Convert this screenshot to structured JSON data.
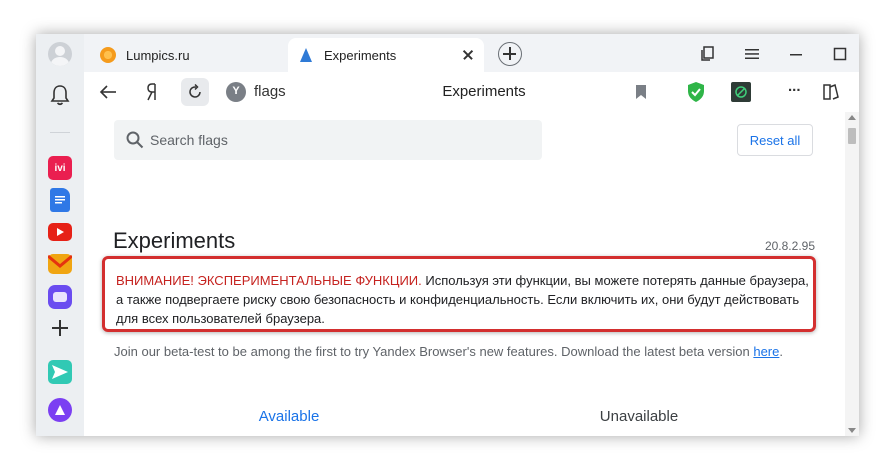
{
  "tabs": [
    {
      "title": "Lumpics.ru"
    },
    {
      "title": "Experiments"
    }
  ],
  "address_bar": {
    "url": "flags",
    "page_title": "Experiments",
    "overflow": "..."
  },
  "sidebar": {
    "apps": [
      {
        "name": "ivi",
        "label": "ivi",
        "color": "#ea1f50"
      },
      {
        "name": "docs",
        "label": "",
        "color": "#2f78e6"
      },
      {
        "name": "youtube",
        "label": "",
        "color": "#e62117"
      },
      {
        "name": "mail",
        "label": "",
        "color": "#f0a512"
      },
      {
        "name": "messenger",
        "label": "",
        "color": "#6a4cf0"
      },
      {
        "name": "send",
        "label": "",
        "color": "#31c9b4"
      },
      {
        "name": "alice",
        "label": "",
        "color": "#7b3ff2"
      }
    ]
  },
  "page": {
    "search_placeholder": "Search flags",
    "reset_label": "Reset all",
    "title": "Experiments",
    "version": "20.8.2.95",
    "warning_head": "ВНИМАНИЕ! ЭКСПЕРИМЕНТАЛЬНЫЕ ФУНКЦИИ.",
    "warning_body": " Используя эти функции, вы можете потерять данные браузера, а также подвергаете риску свою безопасность и конфиденциальность. Если включить их, они будут действовать для всех пользователей браузера.",
    "beta_text": "Join our beta-test to be among the first to try Yandex Browser's new features. Download the latest beta version ",
    "beta_link": "here",
    "beta_end": ".",
    "tab_available": "Available",
    "tab_unavailable": "Unavailable"
  },
  "colors": {
    "accent": "#1a73e8",
    "warning": "#c5221f"
  }
}
